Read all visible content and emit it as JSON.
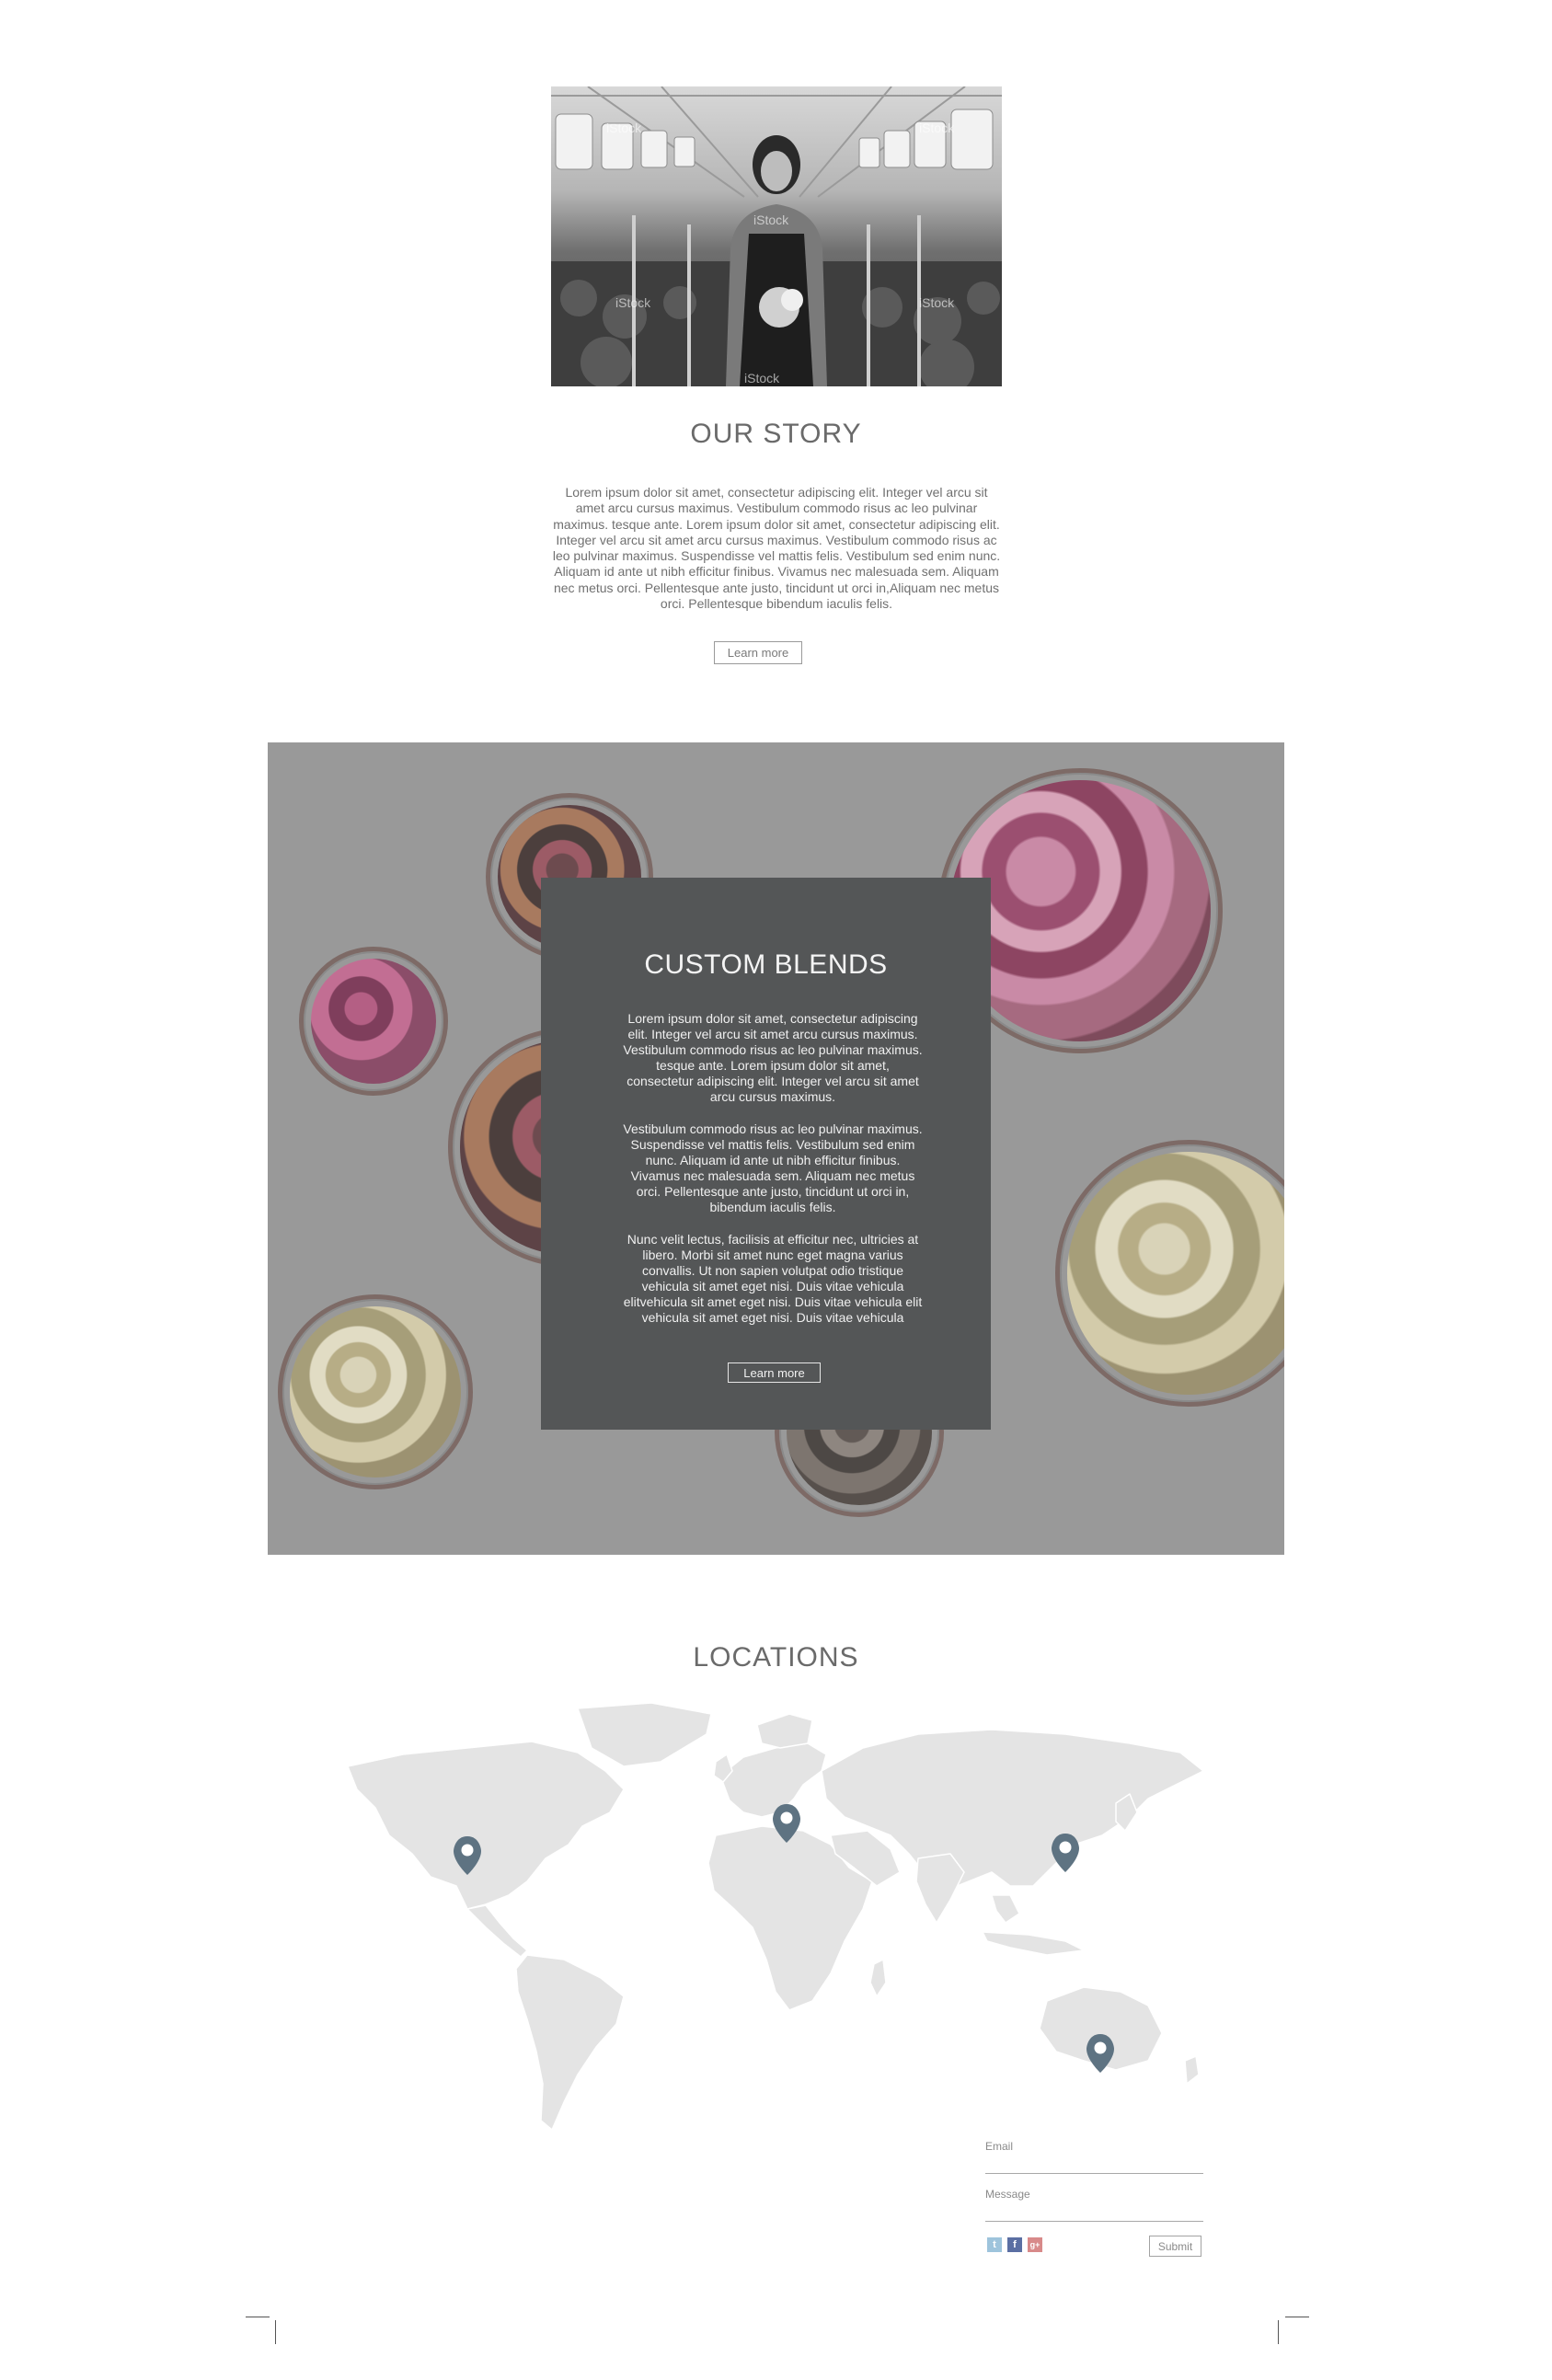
{
  "story": {
    "title": "OUR STORY",
    "body": "Lorem ipsum dolor sit amet, consectetur adipiscing elit. Integer vel arcu sit amet arcu cursus maximus. Vestibulum commodo risus ac leo pulvinar maximus. tesque ante. Lorem ipsum dolor sit amet, consectetur adipiscing elit. Integer vel arcu sit amet arcu cursus maximus. Vestibulum commodo risus ac leo pulvinar maximus. Suspendisse vel mattis felis. Vestibulum sed enim nunc. Aliquam id ante ut nibh efficitur finibus. Vivamus nec malesuada sem. Aliquam nec metus orci. Pellentesque ante justo, tincidunt ut orci in,Aliquam nec metus orci. Pellentesque bibendum iaculis felis.",
    "button_label": "Learn more",
    "photo_watermark": "iStock"
  },
  "blends": {
    "title": "CUSTOM BLENDS",
    "paragraph_1": "Lorem ipsum dolor sit amet, consectetur adipiscing elit. Integer vel arcu sit amet arcu cursus maximus. Vestibulum commodo risus ac leo pulvinar maximus. tesque ante. Lorem ipsum dolor sit amet, consectetur adipiscing elit. Integer vel arcu sit amet arcu cursus maximus.",
    "paragraph_2": "Vestibulum commodo risus ac leo pulvinar maximus. Suspendisse vel mattis felis. Vestibulum sed enim nunc. Aliquam id ante ut nibh efficitur finibus. Vivamus nec malesuada sem. Aliquam nec metus orci. Pellentesque ante justo, tincidunt ut orci in, bibendum iaculis felis.",
    "paragraph_3": "Nunc velit lectus, facilisis at efficitur nec, ultricies at libero. Morbi sit amet nunc eget magna varius convallis. Ut non sapien volutpat odio tristique vehicula sit amet eget nisi. Duis vitae vehicula elitvehicula sit amet eget nisi. Duis vitae vehicula elit  vehicula sit amet eget nisi. Duis vitae vehicula",
    "button_label": "Learn more"
  },
  "locations": {
    "title": "LOCATIONS",
    "pin_color": "#5e7382",
    "map_color": "#e4e4e4"
  },
  "contact": {
    "email_label": "Email",
    "message_label": "Message",
    "submit_label": "Submit",
    "social": [
      {
        "name": "twitter-icon",
        "glyph": "t",
        "color": "#9ec4dc"
      },
      {
        "name": "facebook-icon",
        "glyph": "f",
        "color": "#5b6fa3"
      },
      {
        "name": "google-plus-icon",
        "glyph": "g+",
        "color": "#d88a8a"
      }
    ]
  },
  "colors": {
    "panel_bg": "#545657",
    "section_bg": "#999999",
    "text": "#707070"
  }
}
